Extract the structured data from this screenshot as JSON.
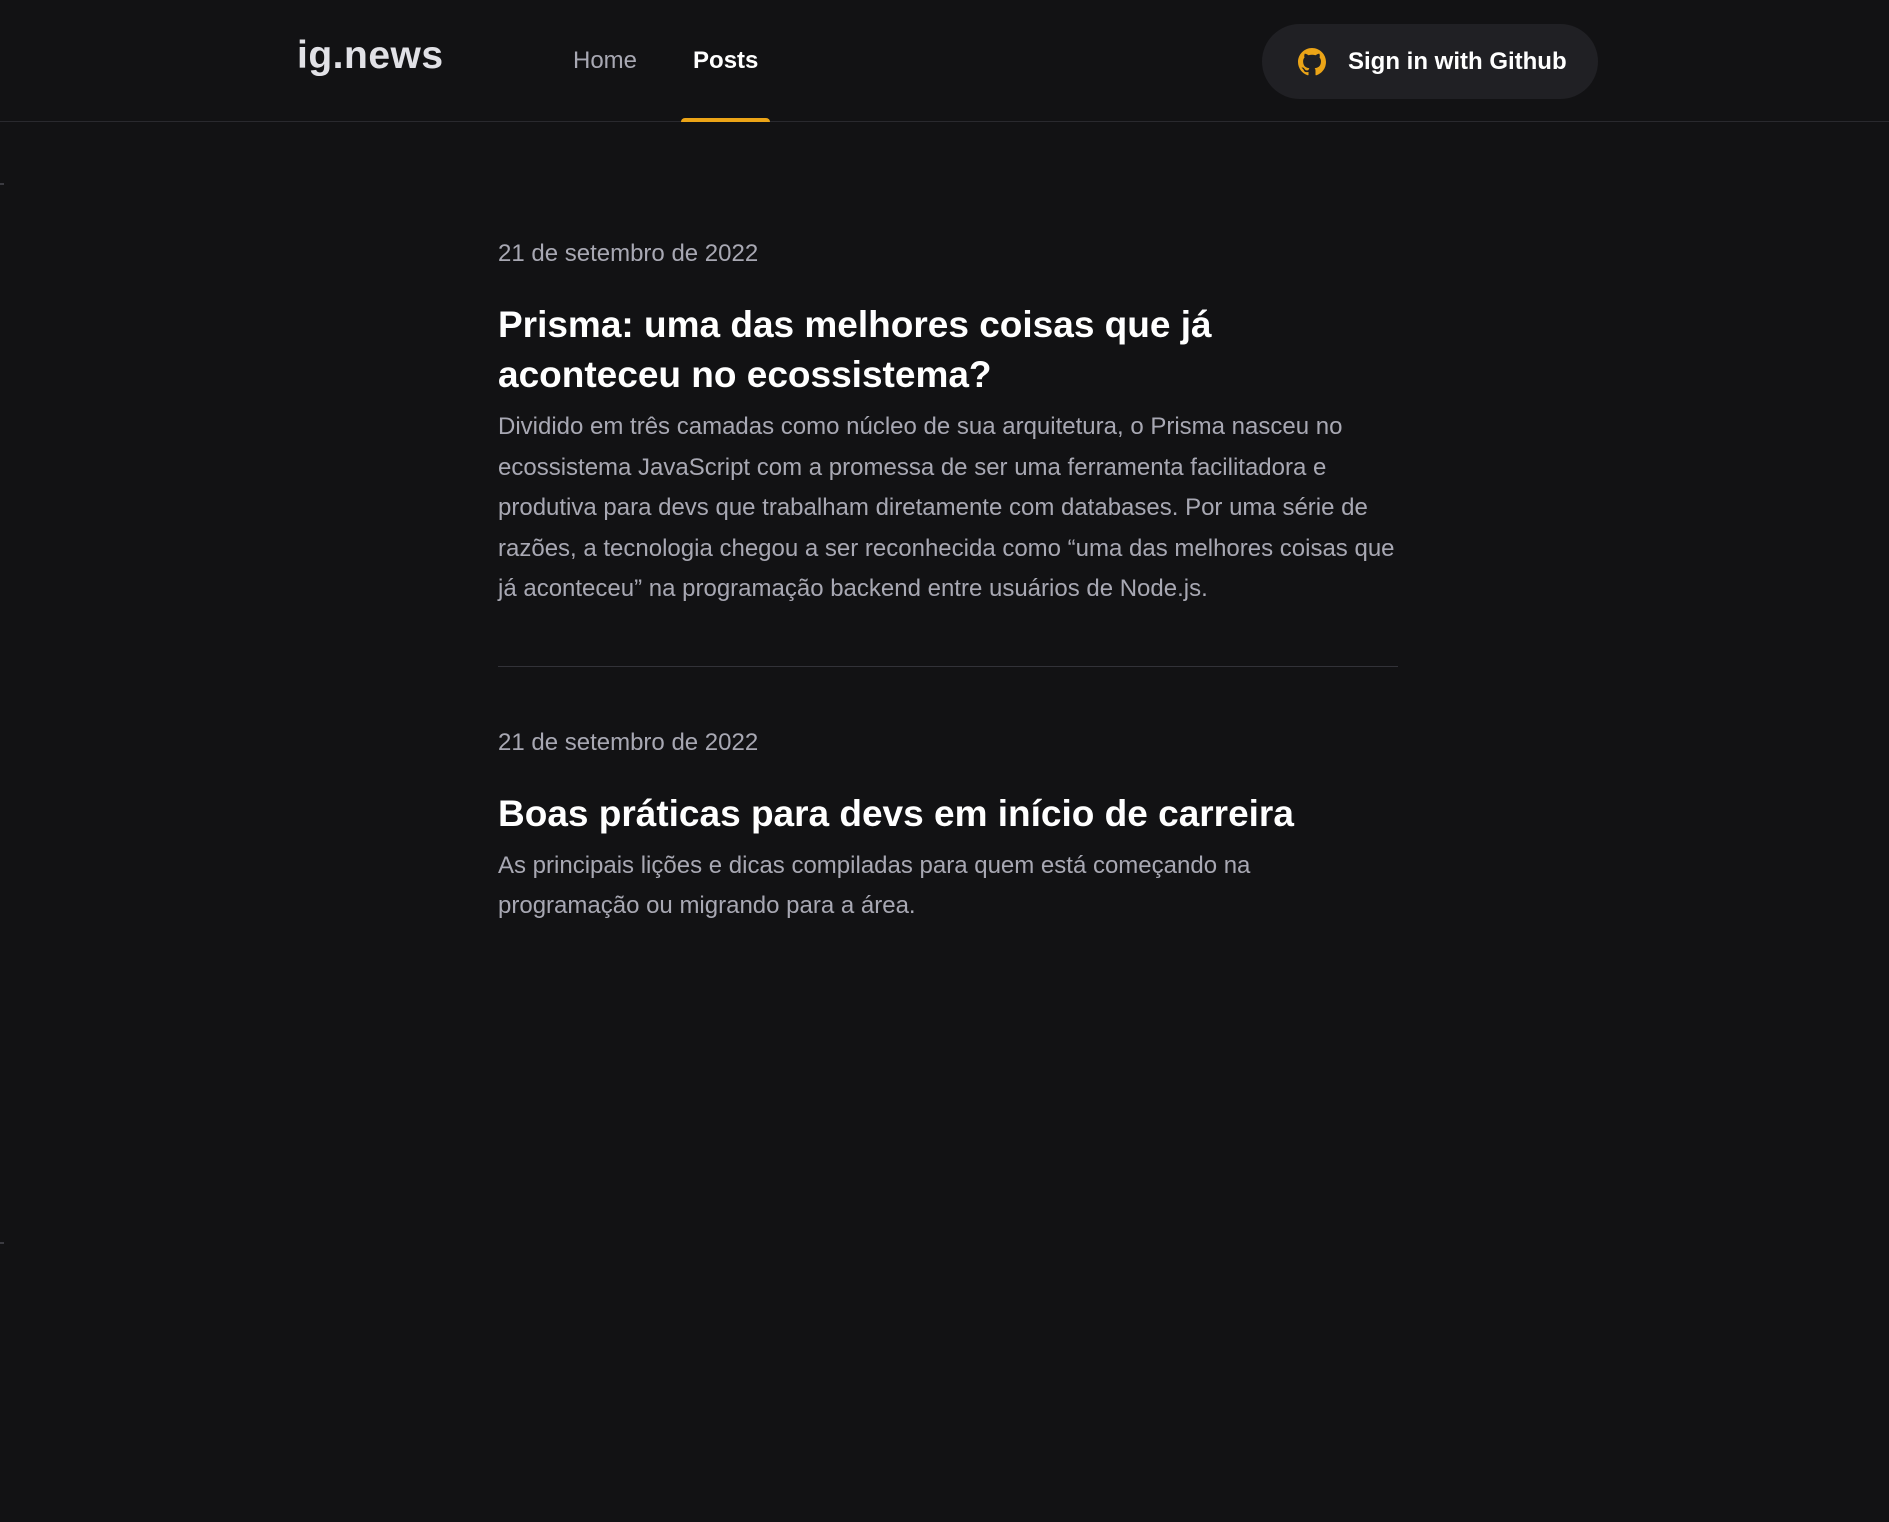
{
  "header": {
    "logo": "ig.news",
    "nav": [
      {
        "label": "Home",
        "active": false
      },
      {
        "label": "Posts",
        "active": true
      }
    ],
    "signin_label": "Sign in with Github",
    "signin_icon": "github-icon",
    "accent_color": "#eba417"
  },
  "posts": [
    {
      "date": "21 de setembro de 2022",
      "title": "Prisma: uma das melhores coisas que já aconteceu no ecossistema?",
      "excerpt": "Dividido em três camadas como núcleo de sua arquitetura, o Prisma nasceu no ecossistema JavaScript com a promessa de ser uma ferramenta facilitadora e produtiva para devs que trabalham diretamente com databases. Por uma série de razões, a tecnologia chegou a ser reconhecida como “uma das melhores coisas que já aconteceu” na programação backend entre usuários de Node.js."
    },
    {
      "date": "21 de setembro de 2022",
      "title": "Boas práticas para devs em início de carreira",
      "excerpt": "As principais lições e dicas compiladas para quem está começando na programação ou migrando para a área."
    }
  ]
}
